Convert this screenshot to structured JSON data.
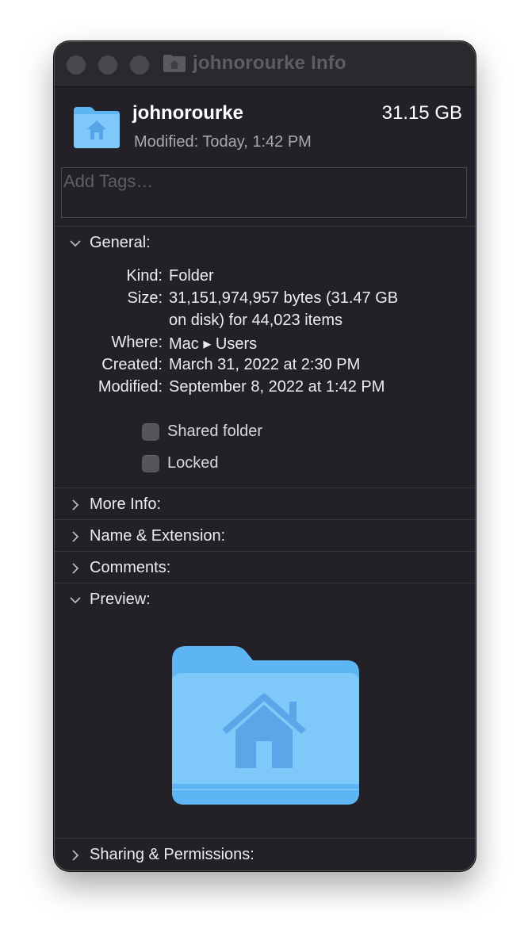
{
  "window": {
    "title": "johnorourke Info"
  },
  "header": {
    "name": "johnorourke",
    "size": "31.15 GB",
    "modified_label": "Modified:",
    "modified_value": "Today, 1:42 PM"
  },
  "tags": {
    "placeholder": "Add Tags…"
  },
  "sections": {
    "general": "General:",
    "more_info": "More Info:",
    "name_extension": "Name & Extension:",
    "comments": "Comments:",
    "preview": "Preview:",
    "sharing": "Sharing & Permissions:"
  },
  "general": {
    "kind_label": "Kind:",
    "kind_value": "Folder",
    "size_label": "Size:",
    "size_value_line1": "31,151,974,957 bytes (31.47 GB",
    "size_value_line2": "on disk) for 44,023 items",
    "where_label": "Where:",
    "where_value": "Mac ▸ Users",
    "created_label": "Created:",
    "created_value": "March 31, 2022 at 2:30 PM",
    "modified_label": "Modified:",
    "modified_value": "September 8, 2022 at 1:42 PM",
    "shared_folder": {
      "label": "Shared folder",
      "checked": false
    },
    "locked": {
      "label": "Locked",
      "checked": false
    }
  },
  "colors": {
    "window_bg": "#232127",
    "folder_blue": "#5eb5f4",
    "folder_light": "#7ec8fa"
  },
  "icons": {
    "title": "home-folder-icon",
    "header": "home-folder-icon",
    "preview": "home-folder-icon"
  }
}
